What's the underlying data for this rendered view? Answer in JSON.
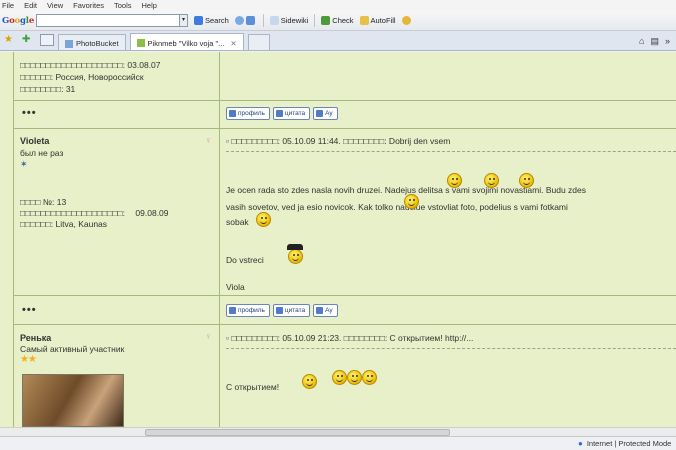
{
  "menu": [
    "File",
    "Edit",
    "View",
    "Favorites",
    "Tools",
    "Help"
  ],
  "toolbar": {
    "logo": "Google",
    "search_value": "",
    "search_label": "Search",
    "sidewiki_label": "Sidewiki",
    "check_label": "Check",
    "autofill_label": "AutoFill"
  },
  "tabs": [
    {
      "label": "PhotoBucket",
      "active": false
    },
    {
      "label": "Piknmeb \"Vilko voja \"...",
      "active": true
    }
  ],
  "posts": [
    {
      "info_lines": [
        {
          "label": "□□□□□□□□□□□□□□□□□□□□:",
          "value": "03.08.07"
        },
        {
          "label": "□□□□□□:",
          "value": "Россия, Новороссийск"
        },
        {
          "label": "□□□□□□□□:",
          "value": "31"
        }
      ]
    },
    {
      "author": "Violeta",
      "rank": "был не раз",
      "number": "□□□□ №: 13",
      "registered_label": "□□□□□□□□□□□□□□□□□□□□:",
      "registered_value": "09.08.09",
      "location": "□□□□□□: Litva, Kaunas",
      "header": "□□□□□□□□□: 05.10.09 11:44. □□□□□□□□: Dobrij den vsem",
      "body_1": "Je ocen rada sto zdes nasla novih druzei. Nadejus delitsa s vami svojimi novastiami. Budu zdes",
      "body_2": "vasih sovetov, ved ja esio novicok. Kak tolko nauciue vstovliat foto, podelius s vami fotkami",
      "body_3": "sobak",
      "greeting": "Do vstreci",
      "signature": "Viola"
    },
    {
      "author": "Ренька",
      "rank": "Самый активный участник",
      "header": "□□□□□□□□□: 05.10.09 21:23. □□□□□□□□: С открытием! http://...",
      "body": "С открытием!"
    }
  ],
  "post_buttons": [
    "профиль",
    "цитата",
    "Ау"
  ],
  "dots": "•••",
  "status": {
    "zone": "Internet | Protected Mode"
  }
}
